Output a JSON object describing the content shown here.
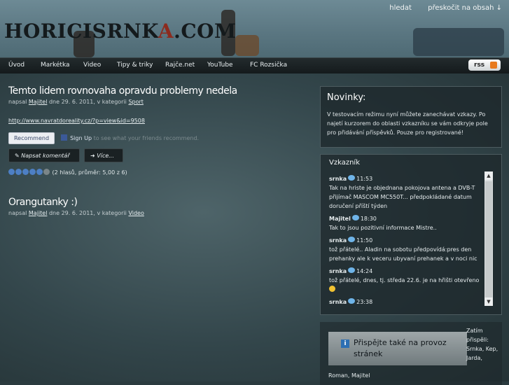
{
  "header": {
    "logo_main": "HORICISRNK",
    "logo_accent": "A",
    "logo_suffix": ".COM",
    "links": [
      "hledat",
      "přeskočit na obsah ↓"
    ]
  },
  "nav": {
    "items": [
      "Úvod",
      "Markétka",
      "Video",
      "Tipy & triky",
      "Rajče.net",
      "YouTube",
      "FC Rozsička"
    ],
    "rss_label": "rss"
  },
  "posts": [
    {
      "title": "Temto lidem rovnovaha opravdu problemy nedela",
      "meta_prefix": "napsal",
      "author": "Majitel",
      "meta_middle": "dne 29. 6. 2011, v kategorii",
      "category": "Sport",
      "link": "http://www.navratdoreality.cz/?p=view&id=9508",
      "fb_recommend": "Recommend",
      "fb_signup": "Sign Up",
      "fb_text": "to see what your friends recommend.",
      "btn_comment": "Napsat komentář",
      "btn_more": "Více...",
      "rating_text": "(2 hlasů, průměr: 5,00 z 6)",
      "rating_stars": 6,
      "rating_filled": 5
    },
    {
      "title": "Orangutanky :)",
      "meta_prefix": "napsal",
      "author": "Majitel",
      "meta_middle": "dne 29. 6. 2011, v kategorii",
      "category": "Video"
    }
  ],
  "novinky": {
    "title": "Novinky:",
    "text": "V testovacím režimu nyní můžete zanechávat vzkazy. Po najetí kurzorem do oblasti vzkazníku se vám odkryje pole pro přidávání příspěvků. Pouze pro registrované!"
  },
  "vzkaznik": {
    "title": "Vzkazník",
    "entries": [
      {
        "user": "srnka",
        "time": "11:53",
        "text": "Tak na hriste je objednana pokojova antena a DVB-T přijímač MASCOM MC550T... předpokládané datum doručení příští týden"
      },
      {
        "user": "Majitel",
        "time": "18:30",
        "text": "Tak to jsou pozitivní informace Mistre.."
      },
      {
        "user": "srnka",
        "time": "11:50",
        "text": "tož přátelé.. Aladin na sobotu předpovídá:pres den prehanky ale k veceru ubyvaní prehanek a v noci nic"
      },
      {
        "user": "srnka",
        "time": "14:24",
        "text": "tož přátelé, dnes, tj. středa 22.6. je na hřišti otevřeno"
      },
      {
        "user": "srnka",
        "time": "23:38",
        "text": ""
      }
    ]
  },
  "contribute": {
    "button": "Přispějte také na provoz stránek",
    "side_text": "Zatím přispěli: Srnka, Kep, Jarda,",
    "bottom_text": "Roman, Majitel"
  }
}
